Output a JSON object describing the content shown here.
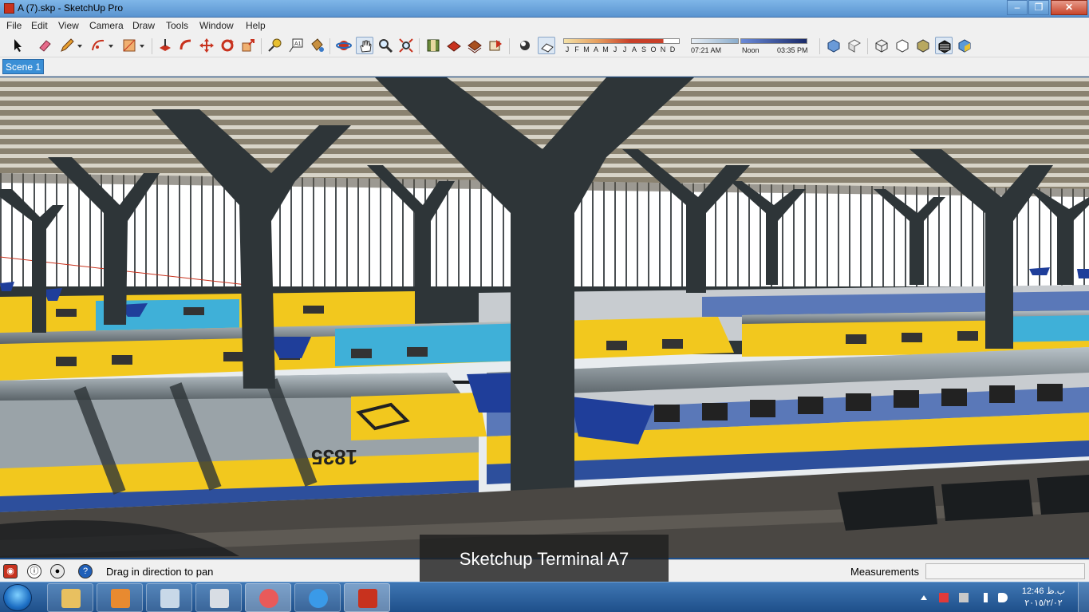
{
  "window": {
    "title": "A (7).skp - SketchUp Pro",
    "minimize": "–",
    "restore": "❐",
    "close": "✕"
  },
  "menu": [
    "File",
    "Edit",
    "View",
    "Camera",
    "Draw",
    "Tools",
    "Window",
    "Help"
  ],
  "toolbar": {
    "months": [
      "J",
      "F",
      "M",
      "A",
      "M",
      "J",
      "J",
      "A",
      "S",
      "O",
      "N",
      "D"
    ],
    "sunrise": "07:21 AM",
    "noon": "Noon",
    "sunset": "03:35 PM"
  },
  "scene_tab": "Scene 1",
  "status": {
    "hint": "Drag in direction to pan",
    "measurements_label": "Measurements",
    "measurements_value": ""
  },
  "caption": "Sketchup Terminal A7",
  "viewport": {
    "train_number": "1835"
  },
  "taskbar": {
    "time": "12:46 ب.ظ",
    "date": "٢٠١٥/٢/٠٢"
  },
  "colors": {
    "train_yellow": "#f2c81e",
    "train_blue": "#2d4f9c",
    "steel": "#2e3538",
    "taskbar": "#1e4f8a",
    "scene_tab": "#3a8fd6"
  }
}
